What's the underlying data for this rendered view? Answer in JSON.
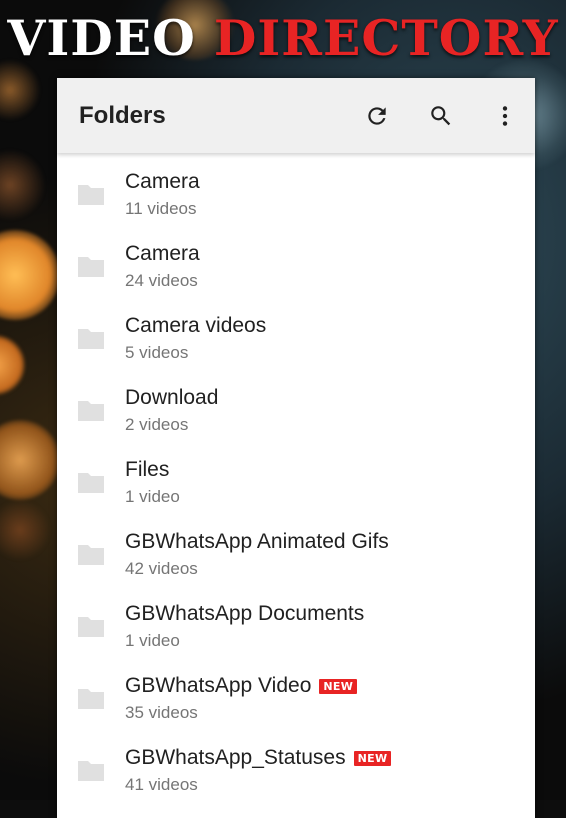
{
  "banner": {
    "word1": "VIDEO",
    "word2": "DIRECTORY"
  },
  "appbar": {
    "title": "Folders",
    "actions": [
      {
        "icon": "refresh-icon"
      },
      {
        "icon": "search-icon"
      },
      {
        "icon": "more-vert-icon"
      }
    ]
  },
  "folders": [
    {
      "name": "Camera",
      "count": "11 videos",
      "badge": ""
    },
    {
      "name": "Camera",
      "count": "24 videos",
      "badge": ""
    },
    {
      "name": "Camera videos",
      "count": "5 videos",
      "badge": ""
    },
    {
      "name": "Download",
      "count": "2 videos",
      "badge": ""
    },
    {
      "name": "Files",
      "count": "1 video",
      "badge": ""
    },
    {
      "name": "GBWhatsApp Animated Gifs",
      "count": "42 videos",
      "badge": ""
    },
    {
      "name": "GBWhatsApp Documents",
      "count": "1 video",
      "badge": ""
    },
    {
      "name": "GBWhatsApp Video",
      "count": "35 videos",
      "badge": "NEW"
    },
    {
      "name": "GBWhatsApp_Statuses",
      "count": "41 videos",
      "badge": "NEW"
    }
  ],
  "colors": {
    "accent": "#e82424",
    "appbar": "#f0f0f0",
    "folder_icon": "#e0e0e0"
  }
}
